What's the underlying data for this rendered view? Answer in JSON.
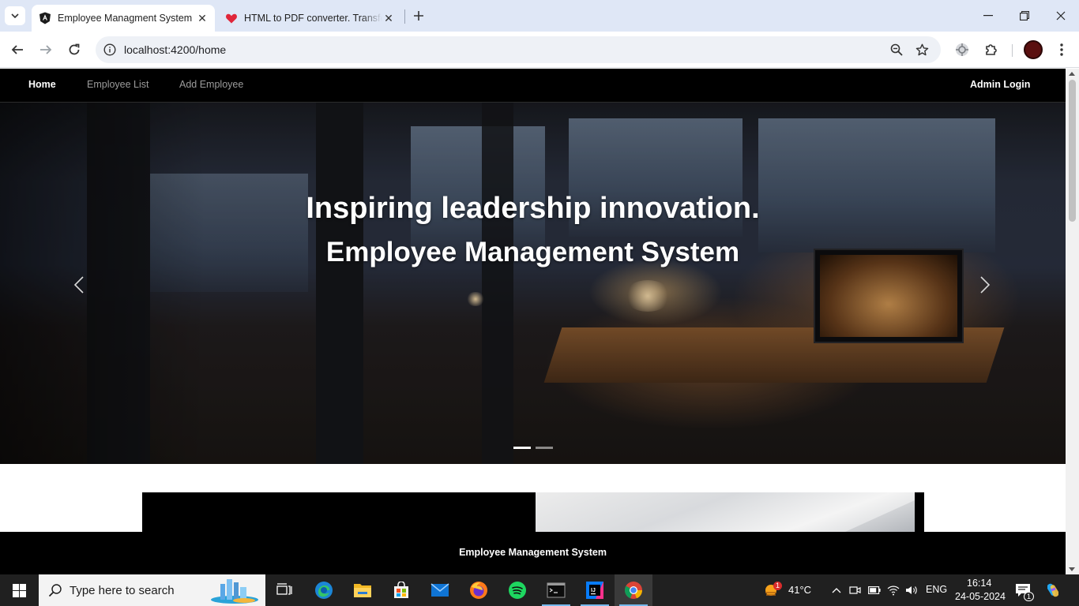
{
  "browser": {
    "tabs": [
      {
        "title": "Employee Managment System",
        "active": true,
        "favicon": "angular-icon"
      },
      {
        "title": "HTML to PDF converter. Transform",
        "active": false,
        "favicon": "heart-icon"
      }
    ],
    "url": "localhost:4200/home"
  },
  "navbar": {
    "links": [
      {
        "label": "Home",
        "active": true
      },
      {
        "label": "Employee List",
        "active": false
      },
      {
        "label": "Add Employee",
        "active": false
      }
    ],
    "admin_label": "Admin Login"
  },
  "carousel": {
    "title": "Inspiring leadership innovation.",
    "subtitle": "Employee Management System",
    "slide_count": 2,
    "active_slide": 1
  },
  "footer": {
    "text": "Employee Management System"
  },
  "taskbar": {
    "search_placeholder": "Type here to search",
    "apps": [
      "task-view-icon",
      "edge-icon",
      "file-explorer-icon",
      "store-icon",
      "mail-icon",
      "firefox-icon",
      "spotify-icon",
      "terminal-icon",
      "intellij-icon",
      "chrome-icon"
    ],
    "weather": {
      "temp": "41°C",
      "badge": "1"
    },
    "language": "ENG",
    "time": "16:14",
    "date": "24-05-2024",
    "notification_count": "1"
  },
  "colors": {
    "navbar_bg": "#000000",
    "tabstrip_bg": "#dfe7f6",
    "taskbar_bg": "#202020"
  }
}
